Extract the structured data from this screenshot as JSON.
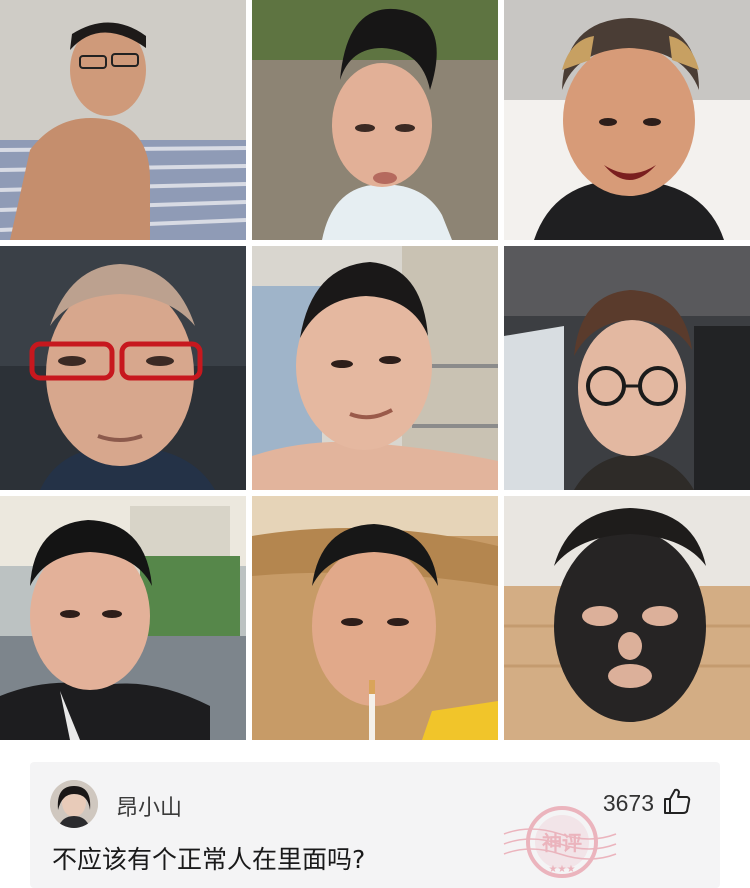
{
  "photos": [
    {
      "subject": "shirtless man lying on striped bed with glasses",
      "icon": "photo-icon"
    },
    {
      "subject": "boy with spiky hair outdoors",
      "icon": "photo-icon"
    },
    {
      "subject": "smiling man with blond-tipped hair",
      "icon": "photo-icon"
    },
    {
      "subject": "older man with red glasses",
      "icon": "photo-icon"
    },
    {
      "subject": "shirtless man lying in bed",
      "icon": "photo-icon"
    },
    {
      "subject": "man with glasses in car",
      "icon": "photo-icon"
    },
    {
      "subject": "man with crew cut outdoors",
      "icon": "photo-icon"
    },
    {
      "subject": "man smoking cigarette",
      "icon": "photo-icon"
    },
    {
      "subject": "man wearing black face mask",
      "icon": "photo-icon"
    }
  ],
  "comment": {
    "username": "昂小山",
    "like_count": "3673",
    "text": "不应该有个正常人在里面吗?",
    "stamp_text": "神评",
    "like_icon": "thumbs-up-icon"
  },
  "colors": {
    "card_bg": "#f4f4f5",
    "stamp": "#d9304a"
  }
}
